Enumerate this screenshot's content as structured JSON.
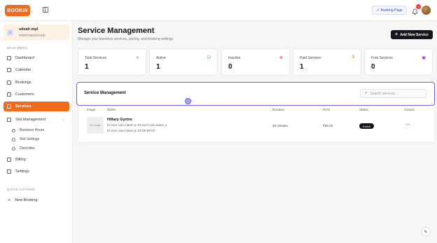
{
  "app": {
    "logo_text": "BOOKIN"
  },
  "topbar": {
    "booking_page_label": "Booking Page",
    "notification_count": "0"
  },
  "sidebar": {
    "user": {
      "name": "sdsah mpl",
      "id": "#WGGN9G6TGHK"
    },
    "main_menu_label": "MAIN MENU",
    "items": [
      {
        "label": "Dashboard"
      },
      {
        "label": "Calendar"
      },
      {
        "label": "Bookings"
      },
      {
        "label": "Customers"
      },
      {
        "label": "Services"
      },
      {
        "label": "Slot Management"
      },
      {
        "label": "Billing"
      },
      {
        "label": "Settings"
      }
    ],
    "sub_items": [
      {
        "label": "Business Hours"
      },
      {
        "label": "Slot Settings"
      },
      {
        "label": "Overrides"
      }
    ],
    "quick_actions_label": "QUICK ACTIONS",
    "quick_actions": [
      {
        "label": "New Booking"
      }
    ]
  },
  "main": {
    "title": "Service Management",
    "subtitle": "Manage your business services, pricing, and booking settings",
    "add_button": "Add New Service",
    "stats": [
      {
        "label": "Total Services",
        "value": "1",
        "icon": "trend-icon",
        "color": "#4a5ab5"
      },
      {
        "label": "Active",
        "value": "1",
        "icon": "check-icon",
        "color": "#2e9a4a"
      },
      {
        "label": "Inactive",
        "value": "0",
        "icon": "x-circle-icon",
        "color": "#e33a3a"
      },
      {
        "label": "Paid Services",
        "value": "1",
        "icon": "dollar-icon",
        "color": "#e0821a"
      },
      {
        "label": "Free Services",
        "value": "0",
        "icon": "gift-icon",
        "color": "#8a3ad6"
      }
    ],
    "panel": {
      "title": "Service Management",
      "search_placeholder": "Search services..."
    },
    "table": {
      "headers": [
        "Image",
        "Name",
        "Duration",
        "Price",
        "Status",
        "Actions"
      ],
      "rows": [
        {
          "image_label": "No Image",
          "name": "Hillary Gyrine",
          "desc_line1": "Et eum iusto tatam p. Et eum iusto tatam p.",
          "desc_line2": "Et eum iusto tatam p. Eit MI BFGF",
          "duration": "48 minutes",
          "price": "₹98.00",
          "status": "Active",
          "actions": "⋯"
        }
      ]
    }
  }
}
